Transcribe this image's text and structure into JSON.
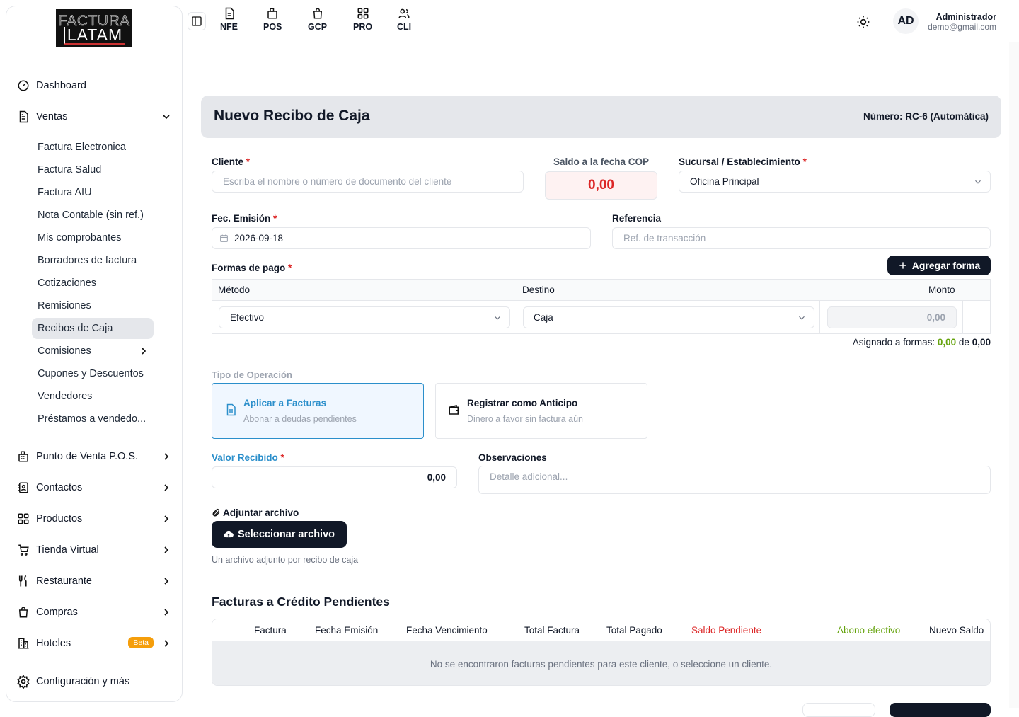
{
  "brand": {
    "line1": "FACTURA",
    "line2": "LATAM"
  },
  "sidebar": {
    "dashboard": "Dashboard",
    "ventas": "Ventas",
    "sub": [
      "Factura Electronica",
      "Factura Salud",
      "Factura AIU",
      "Nota Contable (sin ref.)",
      "Mis comprobantes",
      "Borradores de factura",
      "Cotizaciones",
      "Remisiones",
      "Recibos de Caja",
      "Comisiones",
      "Cupones y Descuentos",
      "Vendedores",
      "Préstamos a vendedo..."
    ],
    "pos": "Punto de Venta P.O.S.",
    "contactos": "Contactos",
    "productos": "Productos",
    "tienda": "Tienda Virtual",
    "restaurante": "Restaurante",
    "compras": "Compras",
    "hoteles": "Hoteles",
    "beta": "Beta",
    "config": "Configuración y más"
  },
  "topnav": [
    "NFE",
    "POS",
    "GCP",
    "PRO",
    "CLI"
  ],
  "user": {
    "initials": "AD",
    "name": "Administrador",
    "email": "demo@gmail.com"
  },
  "header": {
    "title": "Nuevo Recibo de Caja",
    "number": "Número: RC-6 (Automática)"
  },
  "form": {
    "cliente_label": "Cliente",
    "cliente_placeholder": "Escriba el nombre o número de documento del cliente",
    "saldo_label": "Saldo a la fecha COP",
    "saldo_value": "0,00",
    "sucursal_label": "Sucursal / Establecimiento",
    "sucursal_value": "Oficina Principal",
    "fecha_label": "Fec. Emisión",
    "fecha_value": "2026-09-18",
    "referencia_label": "Referencia",
    "referencia_placeholder": "Ref. de transacción",
    "formas_label": "Formas de pago",
    "agregar_label": "Agregar forma",
    "req": "*"
  },
  "pay_table": {
    "headers": [
      "Método",
      "Destino",
      "Monto"
    ],
    "metodo": "Efectivo",
    "destino": "Caja",
    "monto": "0,00",
    "asignado_label": "Asignado a formas:",
    "asignado_value": "0,00",
    "de": "de",
    "total": "0,00"
  },
  "operacion": {
    "label": "Tipo de Operación",
    "opt1_title": "Aplicar a Facturas",
    "opt1_desc": "Abonar a deudas pendientes",
    "opt2_title": "Registrar como Anticipo",
    "opt2_desc": "Dinero a favor sin factura aún"
  },
  "valor": {
    "label": "Valor Recibido",
    "value": "0,00"
  },
  "observaciones": {
    "label": "Observaciones",
    "placeholder": "Detalle adicional..."
  },
  "adjunto": {
    "label": "Adjuntar archivo",
    "button": "Seleccionar archivo",
    "hint": "Un archivo adjunto por recibo de caja"
  },
  "creditos": {
    "title": "Facturas a Crédito Pendientes",
    "headers": [
      "Factura",
      "Fecha Emisión",
      "Fecha Vencimiento",
      "Total Factura",
      "Total Pagado",
      "Saldo Pendiente",
      "Abono efectivo",
      "Nuevo Saldo"
    ],
    "empty": "No se encontraron facturas pendientes para este cliente, o seleccione un cliente."
  },
  "colors": {
    "accent_blue": "#2b8fcb",
    "danger": "#dc2626",
    "success": "#65a30d",
    "dark": "#111827",
    "beta": "#f59e0b"
  }
}
